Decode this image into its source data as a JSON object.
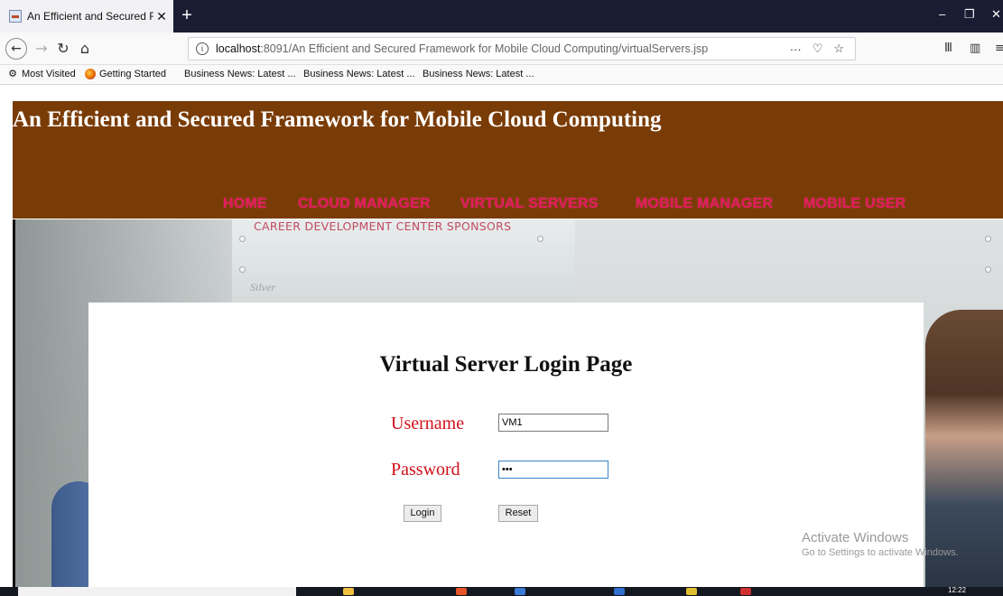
{
  "browser": {
    "tab_title": "An Efficient and Secured Frame",
    "tab_close": "✕",
    "new_tab": "+",
    "window_controls": {
      "minimize": "–",
      "maximize": "❐",
      "close": "✕"
    },
    "url_host": "localhost",
    "url_path": ":8091/An Efficient and Secured Framework for Mobile Cloud Computing/virtualServers.jsp",
    "page_actions": "···",
    "bookmarks": [
      "Most Visited",
      "Getting Started",
      "Business News: Latest ...",
      "Business News: Latest ...",
      "Business News: Latest ..."
    ]
  },
  "site": {
    "title": "An Efficient and Secured Framework for Mobile Cloud Computing",
    "nav": [
      "HOME",
      "CLOUD MANAGER",
      "VIRTUAL SERVERS",
      "MOBILE MANAGER",
      "MOBILE USER"
    ],
    "header_color": "#7a3c06",
    "nav_color": "#e0195b"
  },
  "hero": {
    "sign_text": "CAREER DEVELOPMENT CENTER SPONSORS",
    "sign_sub": "Silver"
  },
  "login": {
    "heading": "Virtual Server Login Page",
    "username_label": "Username",
    "username_value": "VM1",
    "password_label": "Password",
    "password_value": "•••",
    "login_button": "Login",
    "reset_button": "Reset",
    "label_color": "#d1101a"
  },
  "watermark": {
    "line1": "Activate Windows",
    "line2": "Go to Settings to activate Windows."
  },
  "taskbar": {
    "clock": "12:22"
  }
}
